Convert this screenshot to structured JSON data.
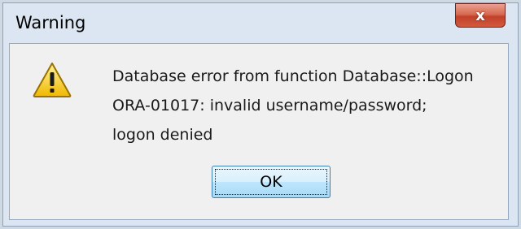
{
  "window": {
    "title": "Warning",
    "close_glyph": "x"
  },
  "message": {
    "line1": "Database error from function Database::Logon",
    "line2": "ORA-01017: invalid username/password;",
    "line3": "logon denied"
  },
  "buttons": {
    "ok_label": "OK"
  },
  "icons": {
    "warning": "warning-triangle-icon",
    "close": "close-icon"
  },
  "colors": {
    "close_button": "#c7432b",
    "warning_fill": "#f5c400",
    "ok_border": "#3c7fb1",
    "client_bg": "#f0f0f0"
  }
}
